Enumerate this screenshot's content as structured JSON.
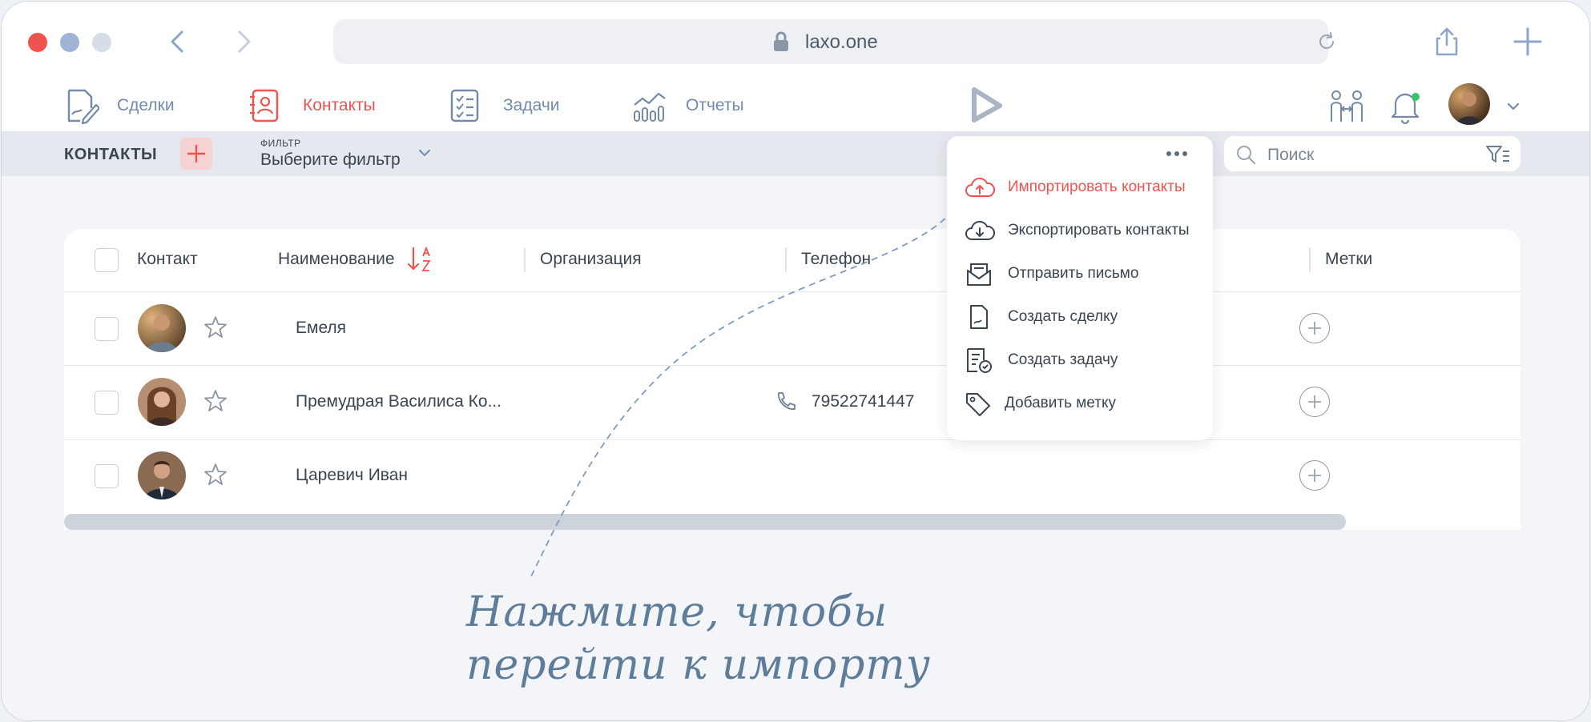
{
  "browser": {
    "url": "laxo.one",
    "traffic_colors": [
      "#ef5350",
      "#9fb3d6",
      "#d7dde6"
    ]
  },
  "nav": {
    "items": [
      {
        "label": "Сделки",
        "icon": "deal-pen-icon",
        "active": false
      },
      {
        "label": "Контакты",
        "icon": "contact-card-icon",
        "active": true
      },
      {
        "label": "Задачи",
        "icon": "task-list-icon",
        "active": false
      },
      {
        "label": "Отчеты",
        "icon": "report-chart-icon",
        "active": false
      }
    ],
    "accent_color": "#ef5350",
    "text_color": "#6f8bb0"
  },
  "toolbar": {
    "title": "КОНТАКТЫ",
    "filter_caption": "ФИЛЬТР",
    "filter_value": "Выберите фильтр",
    "search_placeholder": "Поиск"
  },
  "table": {
    "columns": [
      "Контакт",
      "Наименование",
      "Организация",
      "Телефон",
      "Метки"
    ],
    "rows": [
      {
        "name": "Емеля",
        "organization": "",
        "phone": ""
      },
      {
        "name": "Премудрая Василиса Ко...",
        "organization": "",
        "phone": "79522741447"
      },
      {
        "name": "Царевич Иван",
        "organization": "",
        "phone": ""
      }
    ]
  },
  "menu": {
    "items": [
      {
        "label": "Импортировать контакты",
        "icon": "cloud-upload-icon",
        "highlighted": true
      },
      {
        "label": "Экспортировать контакты",
        "icon": "cloud-download-icon",
        "highlighted": false
      },
      {
        "label": "Отправить письмо",
        "icon": "mail-tray-icon",
        "highlighted": false
      },
      {
        "label": "Создать сделку",
        "icon": "document-icon",
        "highlighted": false
      },
      {
        "label": "Создать задачу",
        "icon": "task-check-icon",
        "highlighted": false
      },
      {
        "label": "Добавить метку",
        "icon": "tag-icon",
        "highlighted": false
      }
    ]
  },
  "hint": {
    "line1": "Нажмите, чтобы",
    "line2": "перейти к импорту"
  }
}
